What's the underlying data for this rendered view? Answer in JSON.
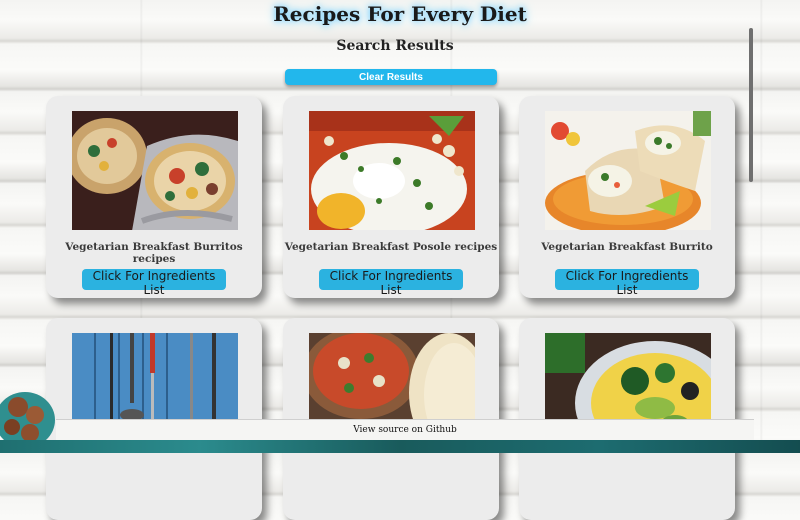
{
  "header": {
    "title": "Recipes For Every Diet",
    "subtitle": "Search Results",
    "clear_label": "Clear Results"
  },
  "cards": [
    {
      "name": "Vegetarian Breakfast Burritos recipes",
      "button": "Click For Ingredients List"
    },
    {
      "name": "Vegetarian Breakfast Posole recipes",
      "button": "Click For Ingredients List"
    },
    {
      "name": "Vegetarian Breakfast Burrito",
      "button": "Click For Ingredients List"
    },
    {
      "name": "",
      "button": ""
    },
    {
      "name": "",
      "button": ""
    },
    {
      "name": "",
      "button": ""
    }
  ],
  "footer": {
    "link_text": "View source on Github"
  },
  "colors": {
    "accent": "#22b7ec",
    "card_bg": "#ececec",
    "title_glow": "#7fd3ff"
  }
}
